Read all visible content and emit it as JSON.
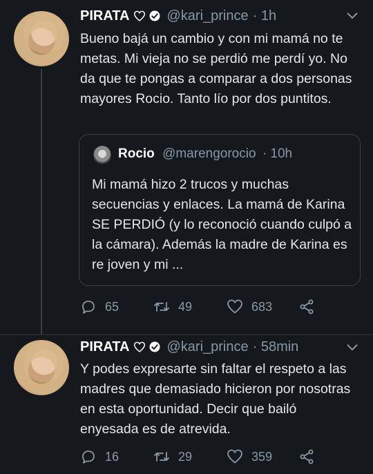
{
  "tweets": [
    {
      "author": "PIRATA",
      "handle": "@kari_prince",
      "time": "· 1h",
      "text": "Bueno bajá un cambio y con mi mamá no te metas. Mi vieja no se perdió me perdí yo. No da que te pongas a comparar a dos personas mayores Rocio. Tanto lío por dos puntitos.",
      "quote": {
        "author": "Rocio",
        "handle": "@marengorocio",
        "time": "· 10h",
        "text": "Mi mamá hizo 2 trucos y muchas secuencias y enlaces. La mamá de Karina SE PERDIÓ (y lo reconoció cuando culpó a la cámara). Además la madre de Karina es re joven y mi ..."
      },
      "replies": "65",
      "retweets": "49",
      "likes": "683"
    },
    {
      "author": "PIRATA",
      "handle": "@kari_prince",
      "time": "· 58min",
      "text": "Y podes expresarte sin faltar el respeto a las madres que demasiado hicieron por nosotras en esta oportunidad. Decir que bailó enyesada es de atrevida.",
      "replies": "16",
      "retweets": "29",
      "likes": "359"
    }
  ],
  "icons": {
    "heart": "heart-outline-icon",
    "verified": "verified-badge-icon",
    "reply": "reply-icon",
    "retweet": "retweet-icon",
    "like": "like-icon",
    "share": "share-icon",
    "more": "chevron-down-icon"
  },
  "colors": {
    "background": "#15181c",
    "text": "#e6e6e6",
    "muted": "#8899a6",
    "border": "#3a3f45"
  }
}
